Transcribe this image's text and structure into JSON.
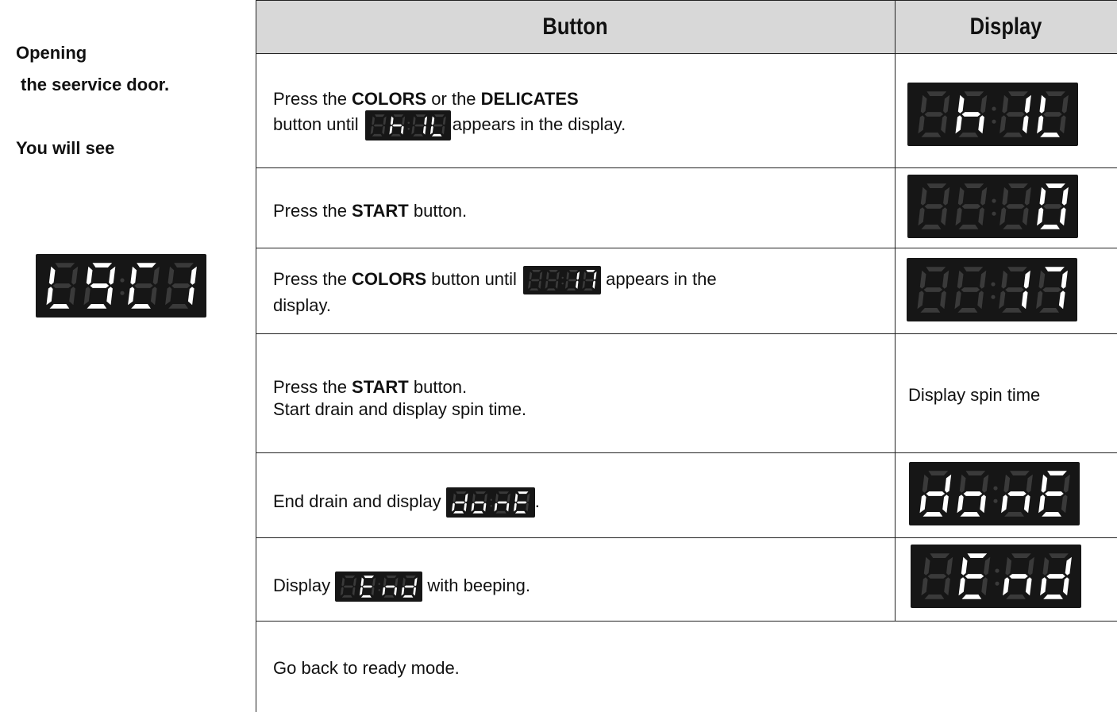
{
  "header": {
    "button_col": "Button",
    "display_col": "Display"
  },
  "left": {
    "line1": "Opening",
    "line2": "the seervice door.",
    "line3": "You will see",
    "display": "L9C1"
  },
  "rows": [
    {
      "pre1": "Press the ",
      "b1": "COLORS",
      "mid1": " or the ",
      "b2": "DELICATES",
      "pre2": "button until ",
      "post2": "appears in the display.",
      "inline": " hILL",
      "display": " hILL"
    },
    {
      "pre": "Press the ",
      "b": "START",
      "post": " button.",
      "display": "   0"
    },
    {
      "pre": "Press the ",
      "b": "COLORS",
      "mid": " button until ",
      "post": " appears in the",
      "line2": "display.",
      "inline": "  17",
      "display": "  17"
    },
    {
      "pre": "Press the ",
      "b": "START",
      "post": " button.",
      "line2": "Start drain and display spin time.",
      "display_text": "Display spin time"
    },
    {
      "pre": "End drain and  display ",
      "post": ".",
      "inline": "donE",
      "display": "donE"
    },
    {
      "pre": "Display ",
      "post": " with beeping.",
      "inline": " End",
      "display": " End"
    },
    {
      "text": "Go back to ready mode."
    }
  ],
  "colors": {
    "header_bg": "#d8d8d8",
    "led_bg": "#161616",
    "led_on": "#ffffff",
    "led_off": "#3a3a3a"
  }
}
